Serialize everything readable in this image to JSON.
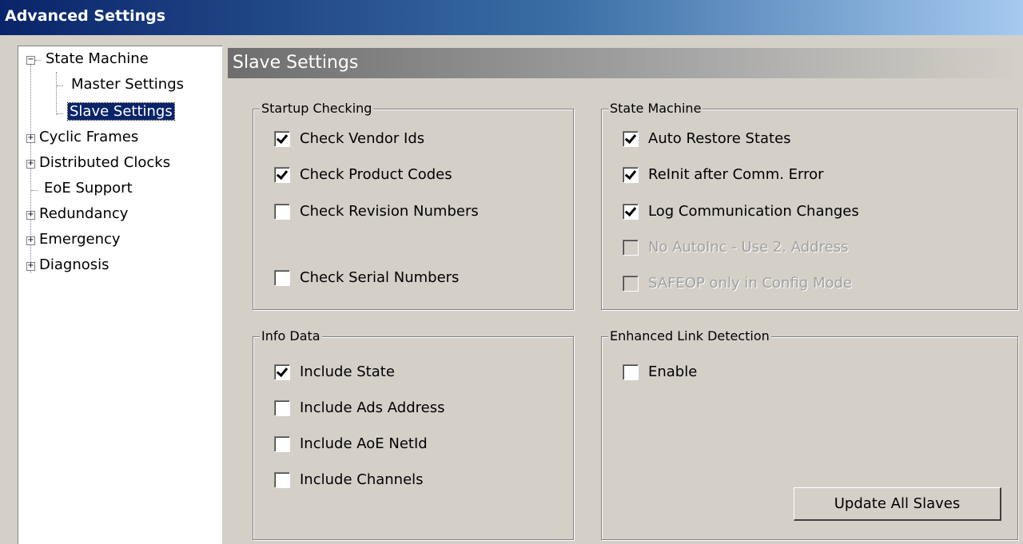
{
  "window": {
    "title": "Advanced Settings"
  },
  "tree": {
    "items": [
      {
        "label": "State Machine",
        "expander": "⊟"
      },
      {
        "label": "Master Settings"
      },
      {
        "label": "Slave Settings",
        "selected": true
      },
      {
        "label": "Cyclic Frames",
        "expander": "⊞"
      },
      {
        "label": "Distributed Clocks",
        "expander": "⊞"
      },
      {
        "label": "EoE Support"
      },
      {
        "label": "Redundancy",
        "expander": "⊞"
      },
      {
        "label": "Emergency",
        "expander": "⊞"
      },
      {
        "label": "Diagnosis",
        "expander": "⊞"
      }
    ]
  },
  "panel": {
    "title": "Slave Settings"
  },
  "startup_checking": {
    "title": "Startup Checking",
    "options": [
      {
        "label": "Check Vendor Ids",
        "checked": true
      },
      {
        "label": "Check Product Codes",
        "checked": true
      },
      {
        "label": "Check Revision Numbers",
        "checked": false
      },
      {
        "label": "Check Serial Numbers",
        "checked": false
      }
    ]
  },
  "state_machine": {
    "title": "State Machine",
    "options": [
      {
        "label": "Auto Restore States",
        "checked": true,
        "enabled": true
      },
      {
        "label": "ReInit after Comm. Error",
        "checked": true,
        "enabled": true
      },
      {
        "label": "Log Communication Changes",
        "checked": true,
        "enabled": true
      },
      {
        "label": "No AutoInc - Use 2. Address",
        "checked": false,
        "enabled": false
      },
      {
        "label": "SAFEOP only in Config Mode",
        "checked": false,
        "enabled": false
      }
    ]
  },
  "info_data": {
    "title": "Info Data",
    "options": [
      {
        "label": "Include State",
        "checked": true
      },
      {
        "label": "Include Ads Address",
        "checked": false
      },
      {
        "label": "Include AoE NetId",
        "checked": false
      },
      {
        "label": "Include Channels",
        "checked": false
      }
    ]
  },
  "enhanced_link": {
    "title": "Enhanced Link Detection",
    "options": [
      {
        "label": "Enable",
        "checked": false
      }
    ],
    "button_label": "Update All Slaves"
  }
}
